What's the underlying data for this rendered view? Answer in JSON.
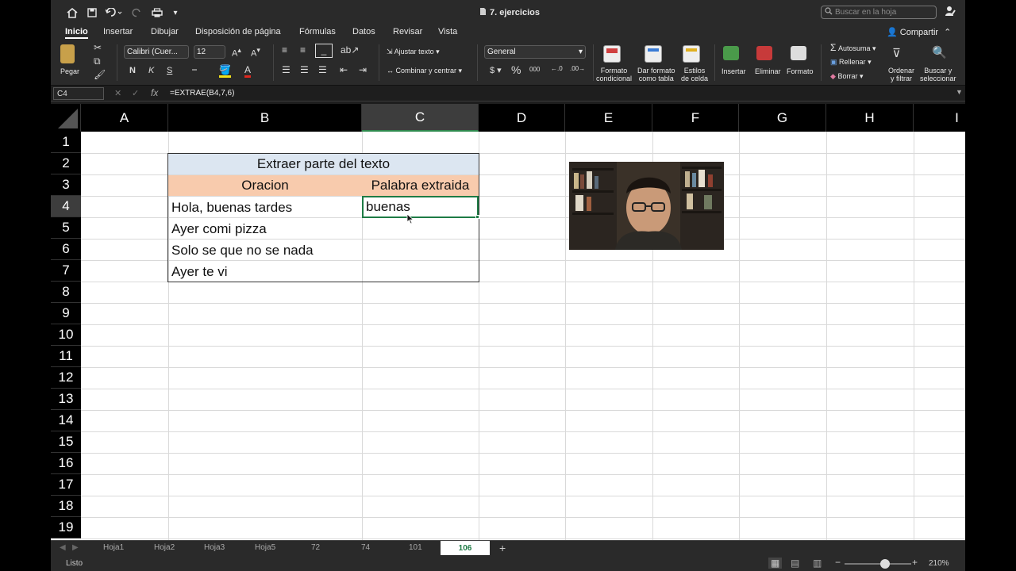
{
  "titlebar": {
    "doc_title": "7. ejercicios",
    "search_placeholder": "Buscar en la hoja"
  },
  "tabs": [
    "Inicio",
    "Insertar",
    "Dibujar",
    "Disposición de página",
    "Fórmulas",
    "Datos",
    "Revisar",
    "Vista"
  ],
  "share": "Compartir",
  "ribbon": {
    "paste": "Pegar",
    "font_name": "Calibri (Cuer...",
    "font_size": "12",
    "wrap_text": "Ajustar texto",
    "merge_center": "Combinar y centrar",
    "number_format": "General",
    "conditional_format_1": "Formato",
    "conditional_format_2": "condicional",
    "format_table_1": "Dar formato",
    "format_table_2": "como tabla",
    "cell_styles_1": "Estilos",
    "cell_styles_2": "de celda",
    "insert": "Insertar",
    "delete": "Eliminar",
    "format": "Formato",
    "autosum": "Autosuma",
    "fill": "Rellenar",
    "clear": "Borrar",
    "sort_1": "Ordenar",
    "sort_2": "y filtrar",
    "find_1": "Buscar y",
    "find_2": "seleccionar"
  },
  "formula_bar": {
    "name_box": "C4",
    "formula": "=EXTRAE(B4,7,6)"
  },
  "columns": [
    "A",
    "B",
    "C",
    "D",
    "E",
    "F",
    "G",
    "H",
    "I"
  ],
  "rows": [
    "1",
    "2",
    "3",
    "4",
    "5",
    "6",
    "7",
    "8",
    "9",
    "10",
    "11",
    "12",
    "13",
    "14",
    "15",
    "16",
    "17",
    "18",
    "19"
  ],
  "table": {
    "title": "Extraer parte del texto",
    "header_b": "Oracion",
    "header_c": "Palabra extraida",
    "sentences": [
      "Hola, buenas tardes",
      "Ayer comi pizza",
      "Solo se que no se nada",
      "Ayer te vi"
    ],
    "extracted_c4": "buenas"
  },
  "sheets": [
    "Hoja1",
    "Hoja2",
    "Hoja3",
    "Hoja5",
    "72",
    "74",
    "101",
    "106"
  ],
  "active_sheet": "106",
  "status": "Listo",
  "zoom": "210%",
  "colors": {
    "title_fill": "#dce6f1",
    "header_fill": "#f8cbad",
    "selection": "#1e7b45"
  }
}
